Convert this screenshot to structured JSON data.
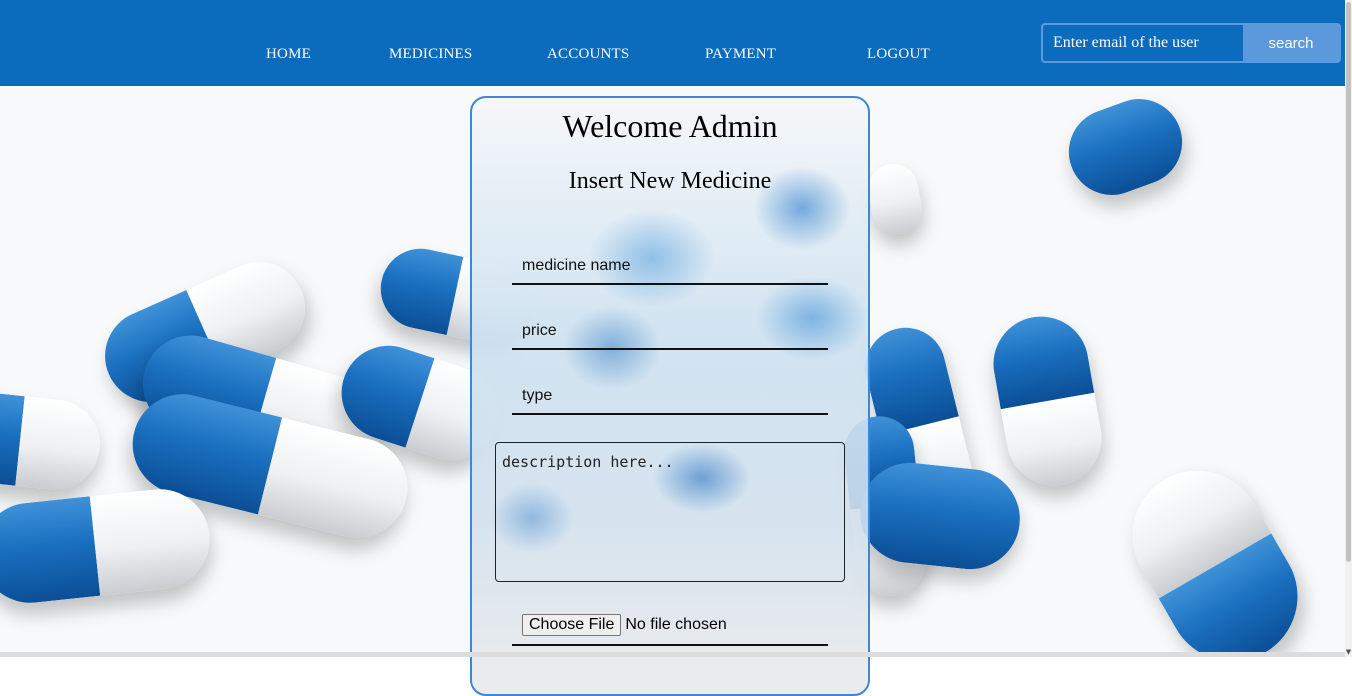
{
  "nav": {
    "items": [
      "HOME",
      "MEDICINES",
      "ACCOUNTS",
      "PAYMENT",
      "LOGOUT"
    ]
  },
  "search": {
    "placeholder": "Enter email of the user",
    "button_label": "search"
  },
  "card": {
    "welcome": "Welcome Admin",
    "subtitle": "Insert New Medicine",
    "fields": {
      "name_placeholder": "medicine name",
      "price_placeholder": "price",
      "type_placeholder": "type",
      "description_placeholder": "description here..."
    },
    "file": {
      "button_label": "Choose File",
      "status": "No file chosen"
    }
  },
  "colors": {
    "header": "#0b6bbd",
    "accent": "#5c98dc",
    "card_border": "#3e86d6"
  }
}
